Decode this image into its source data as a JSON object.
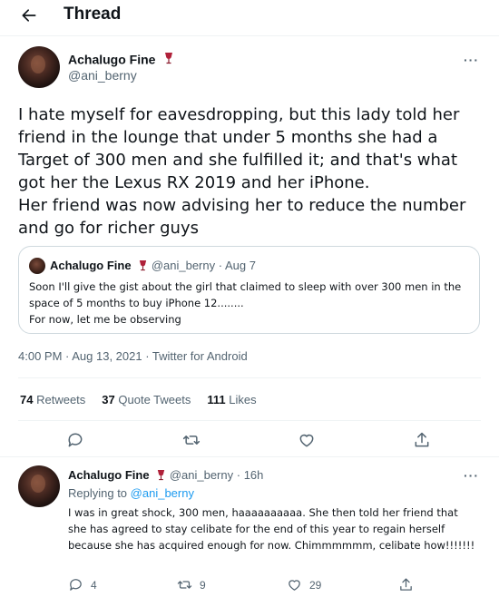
{
  "header": {
    "title": "Thread",
    "back_icon": "arrow-left-icon"
  },
  "main_tweet": {
    "author_name": "Achalugo Fine",
    "author_handle": "@ani_berny",
    "name_emoji": "wine-glass-icon",
    "text_lines": [
      "I hate myself for eavesdropping, but this lady told her friend in the lounge that under 5 months she had a Target of 300 men and she fulfilled it; and that's what got her the Lexus RX 2019 and her iPhone.",
      "Her friend was now advising her to reduce the number and go for richer guys"
    ],
    "quote": {
      "author_name": "Achalugo Fine",
      "author_handle": "@ani_berny",
      "separator": "·",
      "date": "Aug 7",
      "lines": [
        "Soon I'll give the gist about the girl that claimed to sleep with over 300 men in the space of 5 months to buy iPhone 12........",
        "For now, let me be observing"
      ]
    },
    "timestamp": "4:00 PM · Aug 13, 2021 · Twitter for Android",
    "stats": {
      "retweets_count": "74",
      "retweets_label": "Retweets",
      "quotes_count": "37",
      "quotes_label": "Quote Tweets",
      "likes_count": "111",
      "likes_label": "Likes"
    },
    "actions": [
      "reply-icon",
      "retweet-icon",
      "like-icon",
      "share-icon"
    ]
  },
  "reply": {
    "author_name": "Achalugo Fine",
    "author_handle": "@ani_berny",
    "separator": "·",
    "time": "16h",
    "replying_prefix": "Replying to",
    "replying_to": "@ani_berny",
    "text": "I was in great shock, 300 men, haaaaaaaaaa. She then told her friend that she has agreed to stay celibate for the end of this year to regain herself because she has acquired enough for now. Chimmmmmm, celibate how!!!!!!!",
    "reply_count": "4",
    "retweet_count": "9",
    "like_count": "29"
  },
  "colors": {
    "accent": "#1d9bf0",
    "muted": "#536471",
    "text": "#0f1419",
    "border": "#cfd9de"
  }
}
